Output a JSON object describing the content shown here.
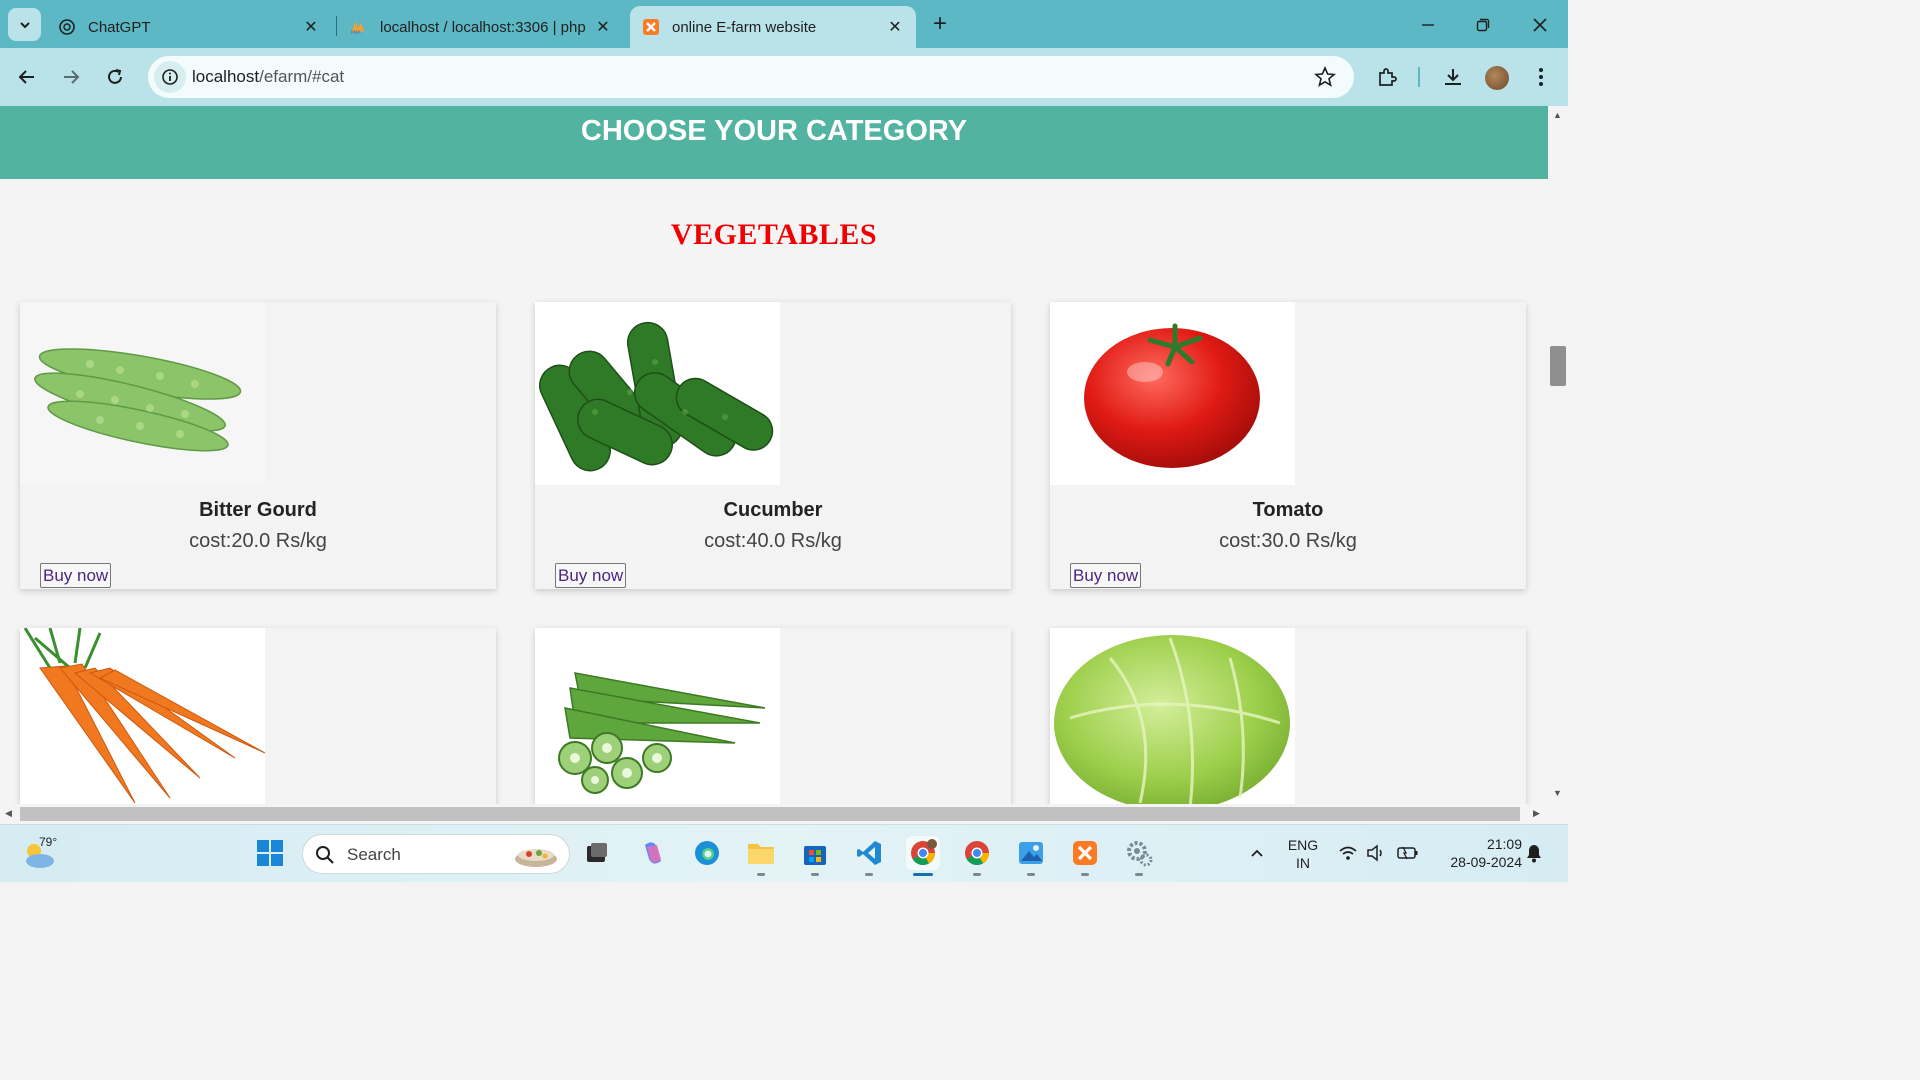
{
  "browser": {
    "tabs": [
      {
        "title": "ChatGPT",
        "icon": "chatgpt-icon",
        "active": false
      },
      {
        "title": "localhost / localhost:3306 | php",
        "icon": "phpmyadmin-icon",
        "active": false
      },
      {
        "title": "online E-farm website",
        "icon": "xampp-icon",
        "active": true
      }
    ],
    "url_host": "localhost",
    "url_path": "/efarm/#cat"
  },
  "page": {
    "banner_title": "CHOOSE YOUR CATEGORY",
    "section_title": "VEGETABLES",
    "products": [
      {
        "name": "Bitter Gourd",
        "cost": "cost:20.0 Rs/kg",
        "button": "Buy now",
        "image": "bitter-gourd"
      },
      {
        "name": "Cucumber",
        "cost": "cost:40.0 Rs/kg",
        "button": "Buy now",
        "image": "cucumber"
      },
      {
        "name": "Tomato",
        "cost": "cost:30.0 Rs/kg",
        "button": "Buy now",
        "image": "tomato"
      },
      {
        "image": "carrot"
      },
      {
        "image": "okra"
      },
      {
        "image": "cabbage"
      }
    ]
  },
  "taskbar": {
    "temperature": "79°",
    "search_placeholder": "Search",
    "language": "ENG",
    "region": "IN",
    "time": "21:09",
    "date": "28-09-2024"
  },
  "colors": {
    "tab_bar": "#5bb8c4",
    "toolbar": "#b9e3e9",
    "banner": "#52b3a0",
    "section_title": "#f00000"
  }
}
